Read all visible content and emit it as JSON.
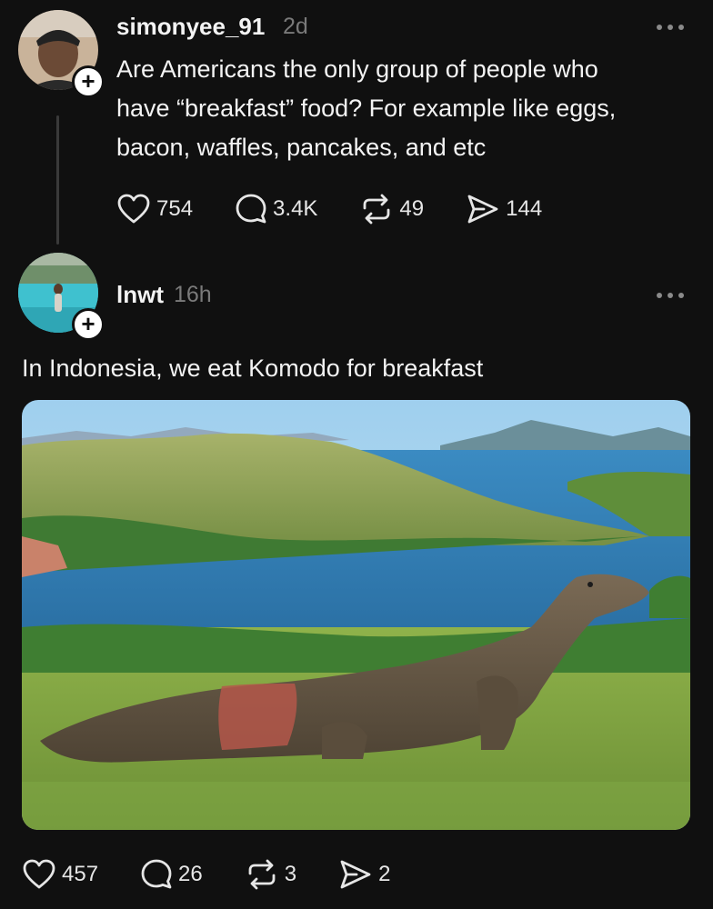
{
  "post": {
    "username": "simonyee_91",
    "time": "2d",
    "text": "Are Americans the only group of people who\nhave “breakfast” food? For example like eggs,\nbacon, waffles, pancakes, and etc",
    "likes": "754",
    "comments": "3.4K",
    "reposts": "49",
    "shares": "144"
  },
  "reply": {
    "username": "lnwt",
    "time": "16h",
    "text": "In Indonesia, we eat Komodo for breakfast",
    "likes": "457",
    "comments": "26",
    "reposts": "3",
    "shares": "2",
    "media": {
      "subject": "komodo-dragon-photo"
    }
  },
  "follow_symbol": "+",
  "icons": {
    "like": "heart-icon",
    "comment": "comment-bubble-icon",
    "repost": "repost-icon",
    "share": "send-icon",
    "more": "more-options-icon"
  },
  "colors": {
    "background": "#101010",
    "text": "#f3f3f3",
    "muted": "#7a7a7a"
  }
}
